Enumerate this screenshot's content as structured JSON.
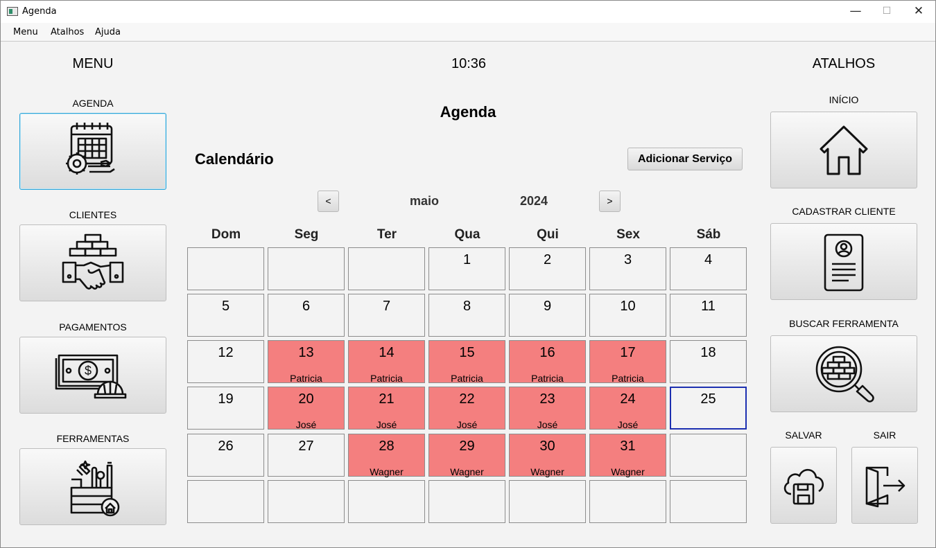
{
  "window": {
    "title": "Agenda",
    "minimize": "—",
    "maximize": "☐",
    "close": "✕"
  },
  "menubar": [
    "Menu",
    "Atalhos",
    "Ajuda"
  ],
  "left": {
    "heading": "MENU",
    "items": [
      {
        "label": "AGENDA",
        "icon": "calendar-gear-icon"
      },
      {
        "label": "CLIENTES",
        "icon": "handshake-bricks-icon"
      },
      {
        "label": "PAGAMENTOS",
        "icon": "money-hardhat-icon"
      },
      {
        "label": "FERRAMENTAS",
        "icon": "toolbox-icon"
      }
    ]
  },
  "clock": "10:36",
  "right": {
    "heading": "ATALHOS",
    "items": [
      {
        "label": "INÍCIO",
        "icon": "home-icon"
      },
      {
        "label": "CADASTRAR CLIENTE",
        "icon": "id-card-icon"
      },
      {
        "label": "BUSCAR FERRAMENTA",
        "icon": "search-bricks-icon"
      },
      {
        "label": "SALVAR",
        "icon": "cloud-save-icon"
      },
      {
        "label": "SAIR",
        "icon": "exit-door-icon"
      }
    ]
  },
  "main": {
    "title": "Agenda",
    "calendar_label": "Calendário",
    "add_service": "Adicionar Serviço",
    "prev": "<",
    "next": ">",
    "month": "maio",
    "year": "2024",
    "weekdays": [
      "Dom",
      "Seg",
      "Ter",
      "Qua",
      "Qui",
      "Sex",
      "Sáb"
    ],
    "weeks": [
      [
        {
          "d": ""
        },
        {
          "d": ""
        },
        {
          "d": ""
        },
        {
          "d": "1"
        },
        {
          "d": "2"
        },
        {
          "d": "3"
        },
        {
          "d": "4"
        }
      ],
      [
        {
          "d": "5"
        },
        {
          "d": "6"
        },
        {
          "d": "7"
        },
        {
          "d": "8"
        },
        {
          "d": "9"
        },
        {
          "d": "10"
        },
        {
          "d": "11"
        }
      ],
      [
        {
          "d": "12"
        },
        {
          "d": "13",
          "who": "Patricia"
        },
        {
          "d": "14",
          "who": "Patricia"
        },
        {
          "d": "15",
          "who": "Patricia"
        },
        {
          "d": "16",
          "who": "Patricia"
        },
        {
          "d": "17",
          "who": "Patricia"
        },
        {
          "d": "18"
        }
      ],
      [
        {
          "d": "19"
        },
        {
          "d": "20",
          "who": "José"
        },
        {
          "d": "21",
          "who": "José"
        },
        {
          "d": "22",
          "who": "José"
        },
        {
          "d": "23",
          "who": "José"
        },
        {
          "d": "24",
          "who": "José"
        },
        {
          "d": "25",
          "today": true
        }
      ],
      [
        {
          "d": "26"
        },
        {
          "d": "27"
        },
        {
          "d": "28",
          "who": "Wagner"
        },
        {
          "d": "29",
          "who": "Wagner"
        },
        {
          "d": "30",
          "who": "Wagner"
        },
        {
          "d": "31",
          "who": "Wagner"
        },
        {
          "d": ""
        }
      ],
      [
        {
          "d": ""
        },
        {
          "d": ""
        },
        {
          "d": ""
        },
        {
          "d": ""
        },
        {
          "d": ""
        },
        {
          "d": ""
        },
        {
          "d": ""
        }
      ]
    ],
    "colors": {
      "booked": "#f47f7f",
      "today_border": "#1c2fb0"
    }
  }
}
